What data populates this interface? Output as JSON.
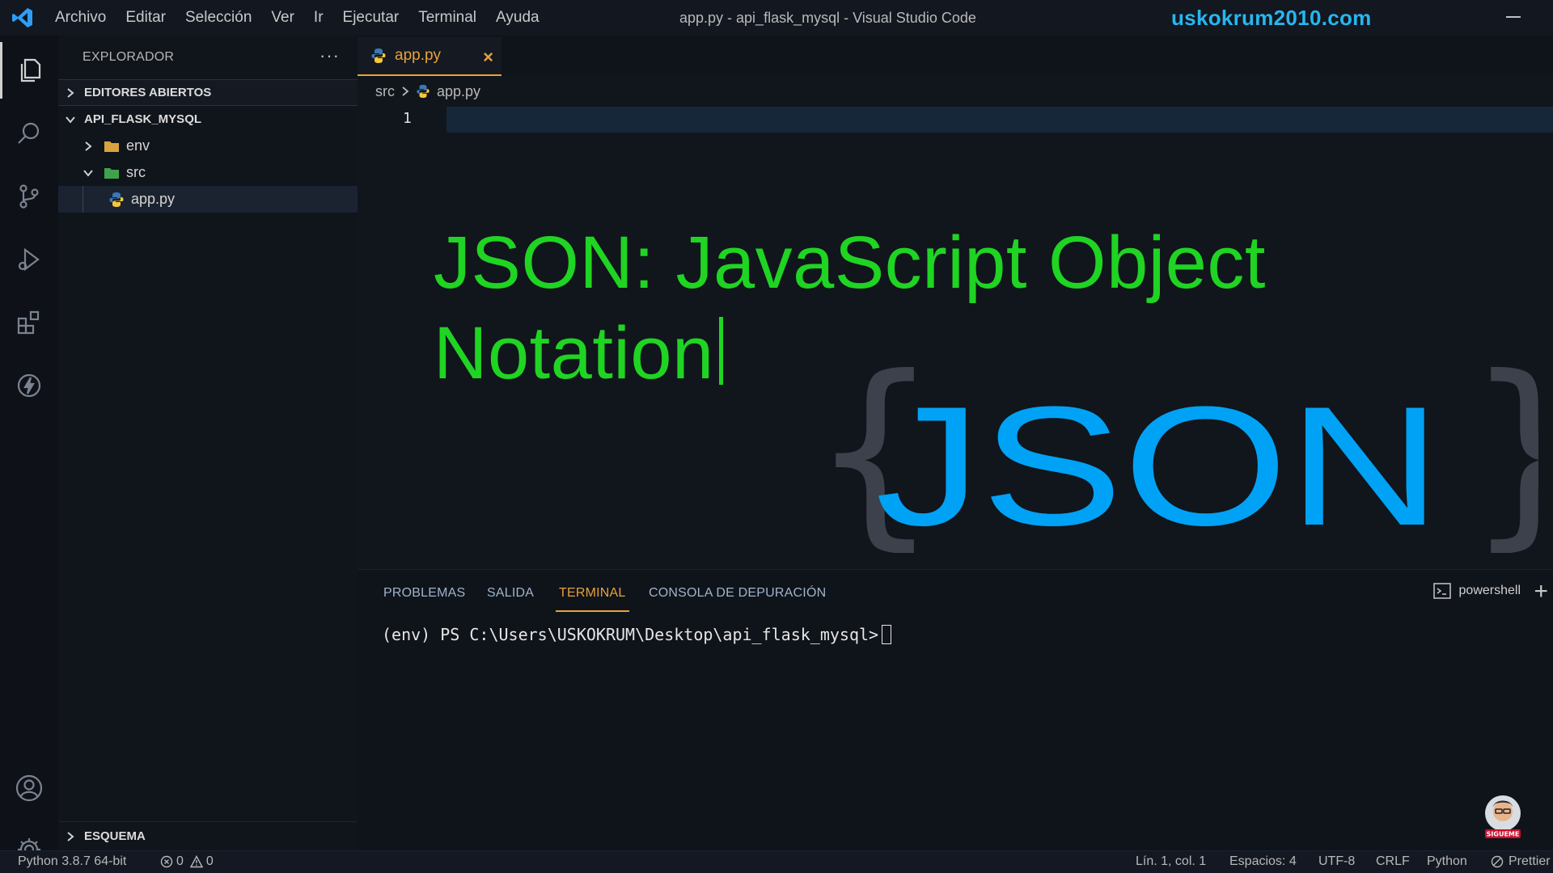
{
  "titlebar": {
    "menu": [
      "Archivo",
      "Editar",
      "Selección",
      "Ver",
      "Ir",
      "Ejecutar",
      "Terminal",
      "Ayuda"
    ],
    "window_title": "app.py - api_flask_mysql - Visual Studio Code",
    "brand": "uskokrum2010.com"
  },
  "sidebar": {
    "title": "EXPLORADOR",
    "more": "···",
    "open_editors": "EDITORES ABIERTOS",
    "project": "API_FLASK_MYSQL",
    "tree": [
      {
        "label": "env"
      },
      {
        "label": "src"
      },
      {
        "label": "app.py"
      }
    ],
    "schema": "ESQUEMA"
  },
  "editor": {
    "tab": {
      "label": "app.py",
      "close": "×"
    },
    "breadcrumb": {
      "folder": "src",
      "file": "app.py"
    },
    "line_number": "1",
    "overlay_line1": "JSON: JavaScript Object",
    "overlay_line2": "Notation",
    "logo_open_brace": "{",
    "logo_word": "JSON",
    "logo_close_brace": "}"
  },
  "panel": {
    "tabs": [
      "PROBLEMAS",
      "SALIDA",
      "TERMINAL",
      "CONSOLA DE DEPURACIÓN"
    ],
    "active_tab": "TERMINAL",
    "shell": "powershell",
    "add": "+",
    "terminal_prompt": "(env) PS C:\\Users\\USKOKRUM\\Desktop\\api_flask_mysql>",
    "avatar_caption": "SIGUEME"
  },
  "statusbar": {
    "interpreter": "Python 3.8.7 64-bit",
    "errors": "0",
    "warnings": "0",
    "position": "Lín. 1, col. 1",
    "spaces": "Espacios: 4",
    "encoding": "UTF-8",
    "eol": "CRLF",
    "language": "Python",
    "prettier": "Prettier"
  },
  "colors": {
    "accent_orange": "#e6a23c",
    "overlay_green": "#1fd422",
    "json_blue": "#00a2f5",
    "brand_blue": "#27b6f0"
  }
}
